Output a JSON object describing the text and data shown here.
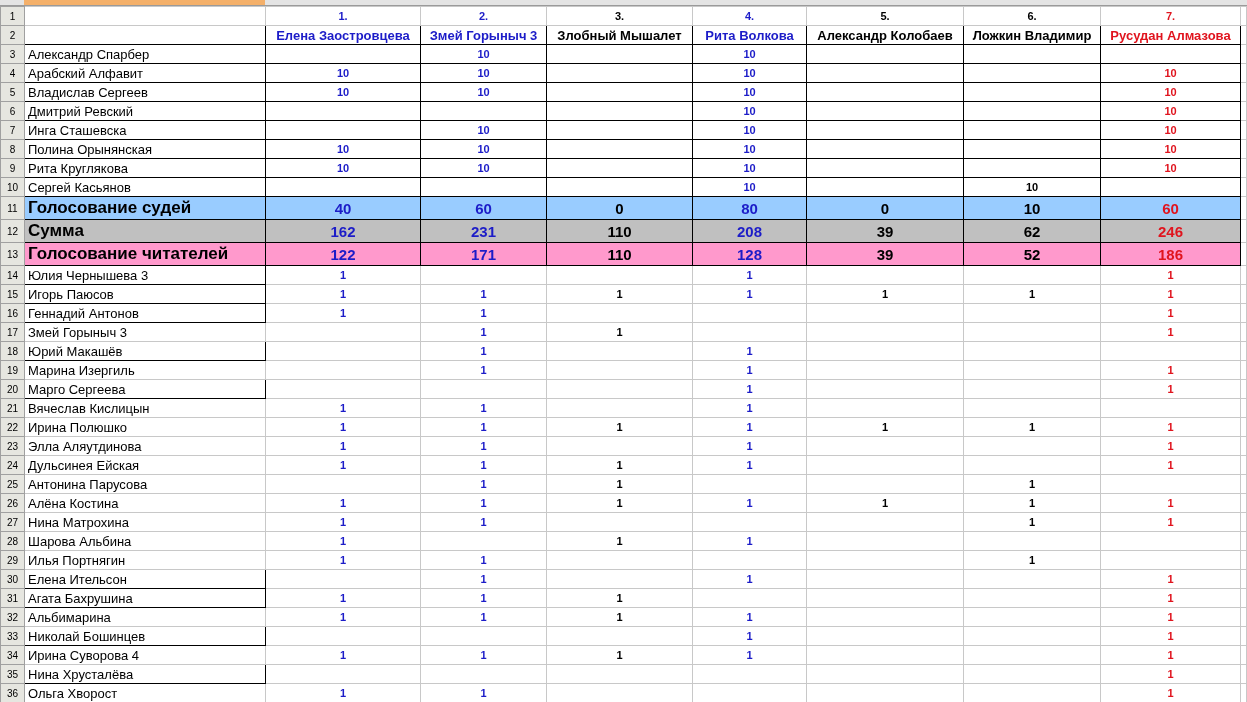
{
  "header_rows": {
    "number_row": "1",
    "name_row": "2"
  },
  "columns": [
    {
      "number": "1.",
      "name": "Елена Заостровцева",
      "color": "#1c1cc8"
    },
    {
      "number": "2.",
      "name": "Змей Горыныч 3",
      "color": "#1c1cc8"
    },
    {
      "number": "3.",
      "name": "Злобный Мышалет",
      "color": "#000000"
    },
    {
      "number": "4.",
      "name": "Рита Волкова",
      "color": "#1c1cc8"
    },
    {
      "number": "5.",
      "name": "Александр Колобаев",
      "color": "#000000"
    },
    {
      "number": "6.",
      "name": "Ложкин Владимир",
      "color": "#000000"
    },
    {
      "number": "7.",
      "name": "Русудан Алмазова",
      "color": "#e0141e"
    }
  ],
  "judge_rows": [
    {
      "row": "3",
      "name": "Александр Спарбер",
      "votes": {
        "1": "10",
        "3": "10"
      }
    },
    {
      "row": "4",
      "name": "Арабский Алфавит",
      "votes": {
        "0": "10",
        "1": "10",
        "3": "10",
        "6": "10"
      }
    },
    {
      "row": "5",
      "name": "Владислав Сергеев",
      "votes": {
        "0": "10",
        "1": "10",
        "3": "10",
        "6": "10"
      }
    },
    {
      "row": "6",
      "name": "Дмитрий Ревский",
      "votes": {
        "3": "10",
        "6": "10"
      }
    },
    {
      "row": "7",
      "name": "Инга Сташевска",
      "votes": {
        "1": "10",
        "3": "10",
        "6": "10"
      }
    },
    {
      "row": "8",
      "name": "Полина Орынянская",
      "votes": {
        "0": "10",
        "1": "10",
        "3": "10",
        "6": "10"
      }
    },
    {
      "row": "9",
      "name": "Рита Круглякова",
      "votes": {
        "0": "10",
        "1": "10",
        "3": "10",
        "6": "10"
      }
    },
    {
      "row": "10",
      "name": "Сергей Касьянов",
      "votes": {
        "3": "10",
        "5": "10"
      }
    }
  ],
  "summary_rows": [
    {
      "row": "11",
      "kind": "judges",
      "label": "Голосование судей",
      "values": [
        "40",
        "60",
        "0",
        "80",
        "0",
        "10",
        "60"
      ]
    },
    {
      "row": "12",
      "kind": "sum",
      "label": "Сумма",
      "values": [
        "162",
        "231",
        "110",
        "208",
        "39",
        "62",
        "246"
      ]
    },
    {
      "row": "13",
      "kind": "readers",
      "label": "Голосование читателей",
      "values": [
        "122",
        "171",
        "110",
        "128",
        "39",
        "52",
        "186"
      ]
    }
  ],
  "reader_rows": [
    {
      "row": "14",
      "name": "Юлия Чернышева 3",
      "boxed": true,
      "votes": {
        "0": "1",
        "3": "1",
        "6": "1"
      }
    },
    {
      "row": "15",
      "name": "Игорь Паюсов",
      "boxed": true,
      "votes": {
        "0": "1",
        "1": "1",
        "2": "1",
        "3": "1",
        "4": "1",
        "5": "1",
        "6": "1"
      }
    },
    {
      "row": "16",
      "name": "Геннадий Антонов",
      "boxed": true,
      "votes": {
        "0": "1",
        "1": "1",
        "6": "1"
      }
    },
    {
      "row": "17",
      "name": "Змей Горыныч 3",
      "boxed": false,
      "votes": {
        "1": "1",
        "2": "1",
        "6": "1"
      }
    },
    {
      "row": "18",
      "name": "Юрий Макашёв",
      "boxed": true,
      "votes": {
        "1": "1",
        "3": "1"
      }
    },
    {
      "row": "19",
      "name": "Марина Изергиль",
      "boxed": false,
      "votes": {
        "1": "1",
        "3": "1",
        "6": "1"
      }
    },
    {
      "row": "20",
      "name": "Марго Сергеева",
      "boxed": true,
      "votes": {
        "3": "1",
        "6": "1"
      }
    },
    {
      "row": "21",
      "name": "Вячеслав Кислицын",
      "boxed": false,
      "votes": {
        "0": "1",
        "1": "1",
        "3": "1"
      }
    },
    {
      "row": "22",
      "name": "Ирина Полюшко",
      "boxed": false,
      "votes": {
        "0": "1",
        "1": "1",
        "2": "1",
        "3": "1",
        "4": "1",
        "5": "1",
        "6": "1"
      }
    },
    {
      "row": "23",
      "name": "Элла Аляутдинова",
      "boxed": false,
      "votes": {
        "0": "1",
        "1": "1",
        "3": "1",
        "6": "1"
      }
    },
    {
      "row": "24",
      "name": "Дульсинея Ейская",
      "boxed": false,
      "votes": {
        "0": "1",
        "1": "1",
        "2": "1",
        "3": "1",
        "6": "1"
      }
    },
    {
      "row": "25",
      "name": "Антонина Парусова",
      "boxed": false,
      "votes": {
        "1": "1",
        "2": "1",
        "5": "1"
      }
    },
    {
      "row": "26",
      "name": "Алёна Костина",
      "boxed": false,
      "votes": {
        "0": "1",
        "1": "1",
        "2": "1",
        "3": "1",
        "4": "1",
        "5": "1",
        "6": "1"
      }
    },
    {
      "row": "27",
      "name": "Нина Матрохина",
      "boxed": false,
      "votes": {
        "0": "1",
        "1": "1",
        "5": "1",
        "6": "1"
      }
    },
    {
      "row": "28",
      "name": "Шарова Альбина",
      "boxed": false,
      "votes": {
        "0": "1",
        "2": "1",
        "3": "1"
      }
    },
    {
      "row": "29",
      "name": "Илья Портнягин",
      "boxed": false,
      "votes": {
        "0": "1",
        "1": "1",
        "5": "1"
      }
    },
    {
      "row": "30",
      "name": "Елена Ительсон",
      "boxed": true,
      "votes": {
        "1": "1",
        "3": "1",
        "6": "1"
      }
    },
    {
      "row": "31",
      "name": "Агата Бахрушина",
      "boxed": true,
      "votes": {
        "0": "1",
        "1": "1",
        "2": "1",
        "6": "1"
      }
    },
    {
      "row": "32",
      "name": "Альбимарина",
      "boxed": false,
      "votes": {
        "0": "1",
        "1": "1",
        "2": "1",
        "3": "1",
        "6": "1"
      }
    },
    {
      "row": "33",
      "name": "Николай Бошинцев",
      "boxed": true,
      "votes": {
        "3": "1",
        "6": "1"
      }
    },
    {
      "row": "34",
      "name": "Ирина Суворова 4",
      "boxed": false,
      "votes": {
        "0": "1",
        "1": "1",
        "2": "1",
        "3": "1",
        "6": "1"
      }
    },
    {
      "row": "35",
      "name": "Нина Хрусталёва",
      "boxed": true,
      "votes": {
        "6": "1"
      }
    },
    {
      "row": "36",
      "name": "Ольга Хворост",
      "boxed": false,
      "votes": {
        "0": "1",
        "1": "1",
        "6": "1"
      }
    }
  ]
}
